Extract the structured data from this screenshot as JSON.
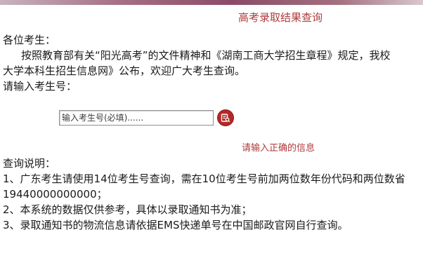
{
  "header": {
    "title": "高考录取结果查询"
  },
  "intro": {
    "greeting": "各位考生：",
    "body_line1": "按照教育部有关“阳光高考”的文件精神和《湖南工商大学招生章程》规定，我校",
    "body_line2": "大学本科生招生信息网》公布，欢迎广大考生查询。",
    "prompt": "请输入考生号："
  },
  "search": {
    "placeholder": "输入考生号(必填)......",
    "value": "",
    "button_icon": "search-icon"
  },
  "validation": {
    "message": "请输入正确的信息"
  },
  "notes": {
    "heading": "查询说明：",
    "items": [
      "1、广东考生请使用14位考生号查询，需在10位考生号前加两位数年份代码和两位数省",
      "19440000000000；",
      "2、本系统的数据仅供参考，具体以录取通知书为准；",
      "3、录取通知书的物流信息请依据EMS快递单号在中国邮政官网自行查询。"
    ]
  },
  "colors": {
    "accent": "#b03a3a",
    "button": "#b52828",
    "top_band": "#8c4a67"
  }
}
